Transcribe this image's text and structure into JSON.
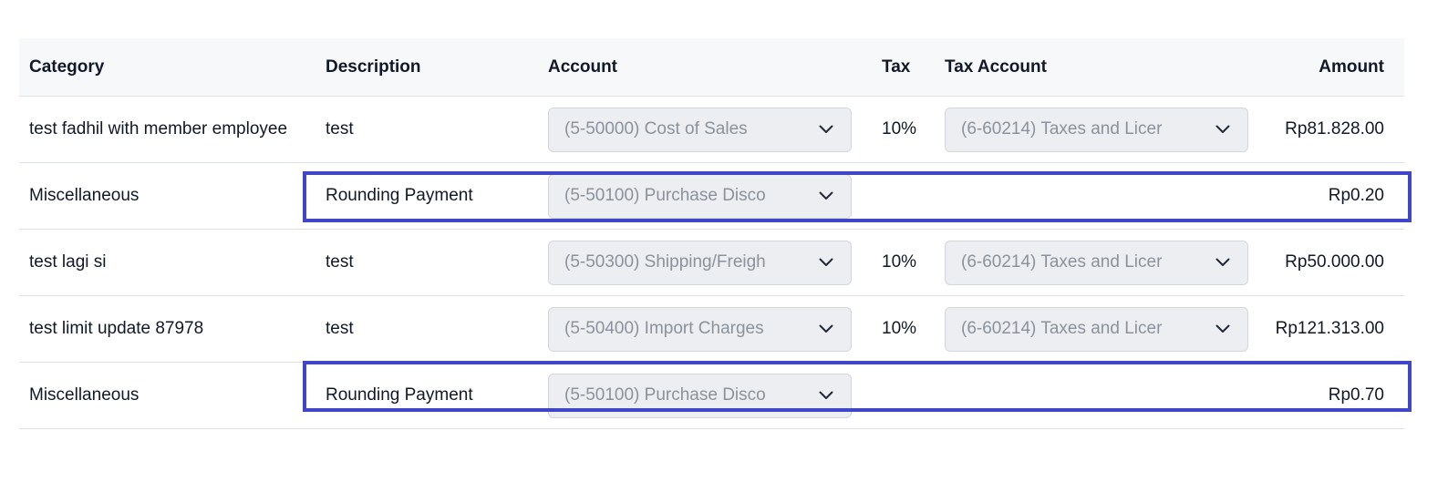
{
  "header": {
    "category": "Category",
    "description": "Description",
    "account": "Account",
    "tax": "Tax",
    "tax_account": "Tax Account",
    "amount": "Amount"
  },
  "rows": [
    {
      "category": "test fadhil with member employee",
      "description": "test",
      "account": "(5-50000) Cost of Sales",
      "tax": "10%",
      "tax_account": "(6-60214) Taxes and Licer",
      "amount": "Rp81.828.00"
    },
    {
      "category": "Miscellaneous",
      "description": "Rounding Payment",
      "account": "(5-50100) Purchase Disco",
      "tax": "",
      "tax_account": "",
      "amount": "Rp0.20"
    },
    {
      "category": "test lagi si",
      "description": "test",
      "account": "(5-50300) Shipping/Freigh",
      "tax": "10%",
      "tax_account": "(6-60214) Taxes and Licer",
      "amount": "Rp50.000.00"
    },
    {
      "category": "test limit update 87978",
      "description": "test",
      "account": "(5-50400) Import Charges",
      "tax": "10%",
      "tax_account": "(6-60214) Taxes and Licer",
      "amount": "Rp121.313.00"
    },
    {
      "category": "Miscellaneous",
      "description": "Rounding Payment",
      "account": "(5-50100) Purchase Disco",
      "tax": "",
      "tax_account": "",
      "amount": "Rp0.70"
    }
  ],
  "colors": {
    "highlight_border": "#3f46c8",
    "select_background": "#eceef1",
    "select_text": "#8b929c",
    "header_background": "#f7f8fa"
  },
  "icons": {
    "select_chevron": "chevron-down-icon"
  }
}
